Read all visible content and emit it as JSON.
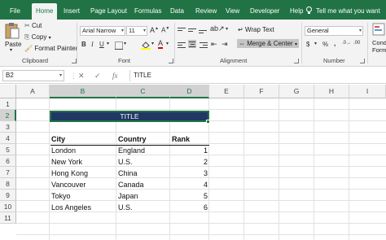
{
  "tabs": [
    "File",
    "Home",
    "Insert",
    "Page Layout",
    "Formulas",
    "Data",
    "Review",
    "View",
    "Developer",
    "Help"
  ],
  "tell_me": "Tell me what you want",
  "clipboard": {
    "paste": "Paste",
    "cut": "Cut",
    "copy": "Copy",
    "format_painter": "Format Painter",
    "label": "Clipboard"
  },
  "font": {
    "family": "Arial Narrow",
    "size": "11",
    "label": "Font",
    "bold": "B",
    "italic": "I",
    "underline": "U"
  },
  "alignment": {
    "wrap_text": "Wrap Text",
    "merge_center": "Merge & Center",
    "label": "Alignment"
  },
  "number": {
    "format": "General",
    "currency": "$",
    "percent": "%",
    "comma": ",",
    "label": "Number"
  },
  "styles": {
    "conditional": "Cond",
    "formatting": "Form"
  },
  "formula_bar": {
    "name_box": "B2",
    "fx": "fx",
    "content": "TITLE"
  },
  "columns": [
    "A",
    "B",
    "C",
    "D",
    "E",
    "F",
    "G",
    "H",
    "I"
  ],
  "rows": [
    "1",
    "2",
    "3",
    "4",
    "5",
    "6",
    "7",
    "8",
    "9",
    "10",
    "11"
  ],
  "sheet": {
    "title": "TITLE",
    "headers": [
      "City",
      "Country",
      "Rank"
    ],
    "data": [
      [
        "London",
        "England",
        "1"
      ],
      [
        "New York",
        "U.S.",
        "2"
      ],
      [
        "Hong Kong",
        "China",
        "3"
      ],
      [
        "Vancouver",
        "Canada",
        "4"
      ],
      [
        "Tokyo",
        "Japan",
        "5"
      ],
      [
        "Los Angeles",
        "U.S.",
        "6"
      ]
    ]
  },
  "colors": {
    "excel_green": "#217346",
    "title_fill": "#1f3864"
  }
}
